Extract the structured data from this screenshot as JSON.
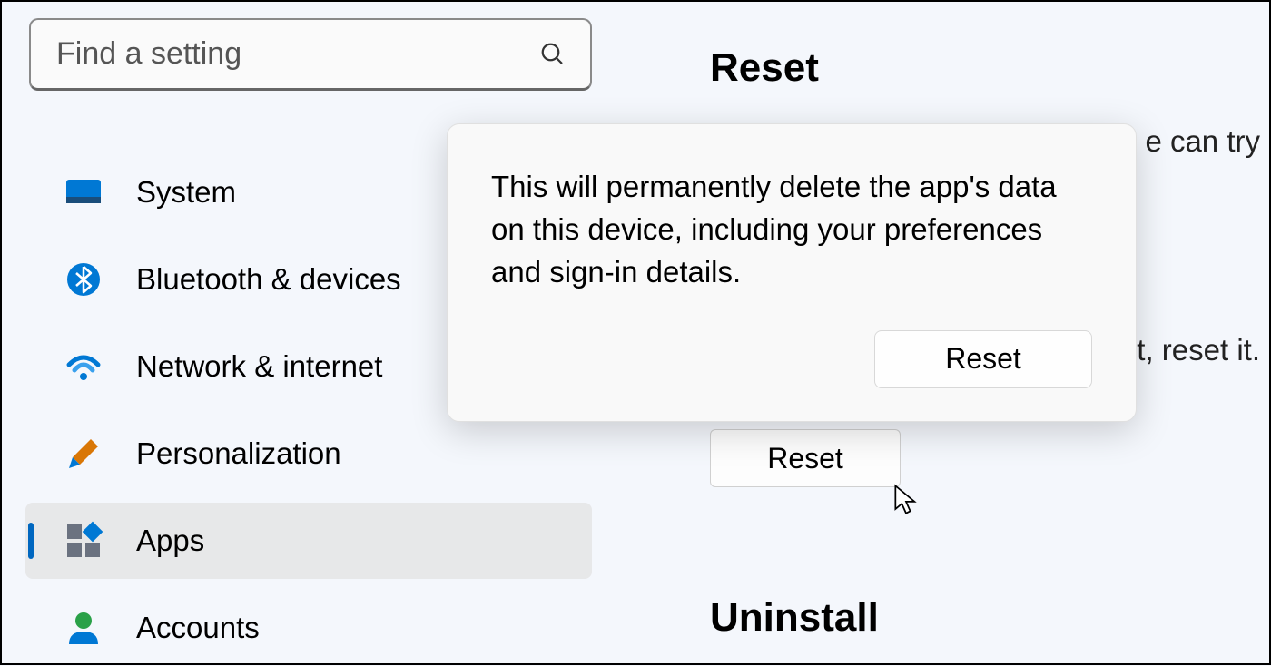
{
  "search": {
    "placeholder": "Find a setting"
  },
  "sidebar": {
    "items": [
      {
        "label": "System",
        "icon": "system-icon"
      },
      {
        "label": "Bluetooth & devices",
        "icon": "bluetooth-icon"
      },
      {
        "label": "Network & internet",
        "icon": "wifi-icon"
      },
      {
        "label": "Personalization",
        "icon": "paintbrush-icon"
      },
      {
        "label": "Apps",
        "icon": "apps-icon"
      },
      {
        "label": "Accounts",
        "icon": "accounts-icon"
      }
    ],
    "active_index": 4
  },
  "main": {
    "reset_heading": "Reset",
    "partial_top": "e can try",
    "partial_mid": "t, reset it.",
    "reset_button_label": "Reset",
    "uninstall_heading": "Uninstall"
  },
  "flyout": {
    "message": "This will permanently delete the app's data on this device, including your preferences and sign-in details.",
    "confirm_label": "Reset"
  }
}
